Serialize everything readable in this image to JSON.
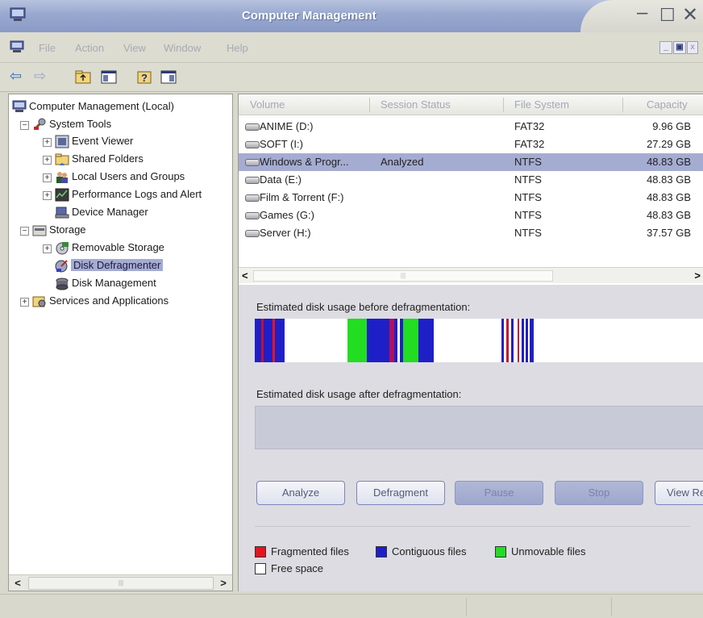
{
  "window": {
    "title": "Computer Management"
  },
  "menu": {
    "items": [
      "File",
      "Action",
      "View",
      "Window",
      "Help"
    ]
  },
  "tree": {
    "root": "Computer Management (Local)",
    "system_tools": "System Tools",
    "event_viewer": "Event Viewer",
    "shared_folders": "Shared Folders",
    "local_users": "Local Users and Groups",
    "perf_logs": "Performance Logs and Alert",
    "device_manager": "Device Manager",
    "storage": "Storage",
    "removable_storage": "Removable Storage",
    "disk_defragmenter": "Disk Defragmenter",
    "disk_management": "Disk Management",
    "services": "Services and Applications"
  },
  "volumes": {
    "columns": [
      "Volume",
      "Session Status",
      "File System",
      "Capacity"
    ],
    "rows": [
      {
        "volume": "ANIME (D:)",
        "status": "",
        "fs": "FAT32",
        "capacity": "9.96 GB"
      },
      {
        "volume": "SOFT (I:)",
        "status": "",
        "fs": "FAT32",
        "capacity": "27.29 GB"
      },
      {
        "volume": "Windows & Progr...",
        "status": "Analyzed",
        "fs": "NTFS",
        "capacity": "48.83 GB"
      },
      {
        "volume": "Data (E:)",
        "status": "",
        "fs": "NTFS",
        "capacity": "48.83 GB"
      },
      {
        "volume": "Film & Torrent (F:)",
        "status": "",
        "fs": "NTFS",
        "capacity": "48.83 GB"
      },
      {
        "volume": "Games (G:)",
        "status": "",
        "fs": "NTFS",
        "capacity": "48.83 GB"
      },
      {
        "volume": "Server (H:)",
        "status": "",
        "fs": "NTFS",
        "capacity": "37.57 GB"
      }
    ],
    "selected_index": 2
  },
  "defrag": {
    "before_label": "Estimated disk usage before defragmentation:",
    "after_label": "Estimated disk usage after defragmentation:",
    "buttons": {
      "analyze": "Analyze",
      "defragment": "Defragment",
      "pause": "Pause",
      "stop": "Stop",
      "view_report": "View Re"
    },
    "legend": {
      "fragmented": "Fragmented files",
      "contiguous": "Contiguous files",
      "unmovable": "Unmovable files",
      "free": "Free space"
    },
    "colors": {
      "fragmented": "#e8141c",
      "contiguous": "#1f1fc8",
      "unmovable": "#22dd22",
      "free": "#ffffff"
    }
  }
}
